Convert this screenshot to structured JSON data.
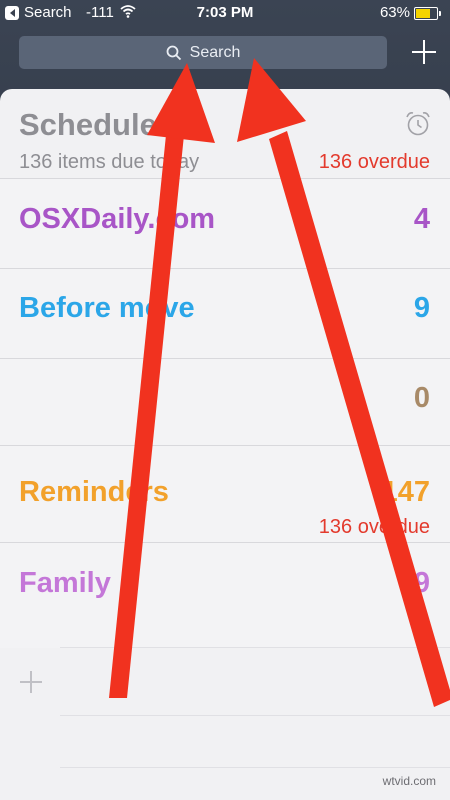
{
  "status_bar": {
    "back_label": "Search",
    "signal": "-111",
    "time": "7:03 PM",
    "battery": "63%"
  },
  "search": {
    "label": "Search"
  },
  "card": {
    "title": "Scheduled",
    "subtitle": "136 items due today",
    "overdue": "136 overdue"
  },
  "lists": [
    {
      "name": "OSXDaily.com",
      "count": "4",
      "color": "#a855c7"
    },
    {
      "name": "Before move",
      "count": "9",
      "color": "#2ba6e8"
    },
    {
      "name": "",
      "count": "0",
      "color": "#a88a68"
    },
    {
      "name": "Reminders",
      "count": "147",
      "overdue": "136 overdue",
      "color": "#f2a12b"
    },
    {
      "name": "Family",
      "count": "9",
      "color": "#c477d8"
    }
  ],
  "colors": {
    "annotation_arrows": "#f1321f",
    "overdue": "#e33a2d"
  },
  "watermark": "wtvid.com"
}
